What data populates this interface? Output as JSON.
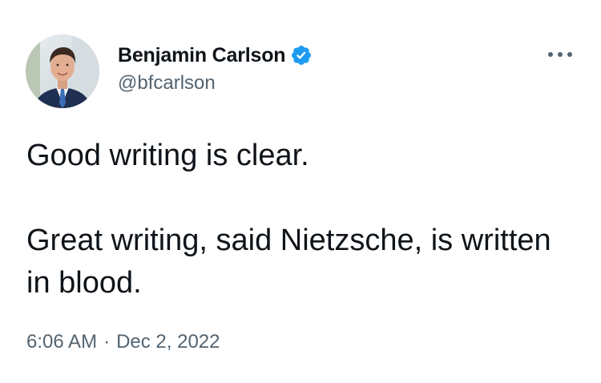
{
  "author": {
    "display_name": "Benjamin Carlson",
    "handle": "@bfcarlson",
    "verified": true
  },
  "tweet": {
    "lines": [
      "Good writing is clear.",
      "Great writing, said Nietzsche, is written in blood."
    ]
  },
  "meta": {
    "time": "6:06 AM",
    "separator": "·",
    "date": "Dec 2, 2022"
  },
  "icons": {
    "verified": "verified-badge-icon",
    "more": "more-options-icon"
  },
  "colors": {
    "text": "#0f1419",
    "secondary": "#536471",
    "verified": "#1d9bf0",
    "background": "#ffffff"
  }
}
